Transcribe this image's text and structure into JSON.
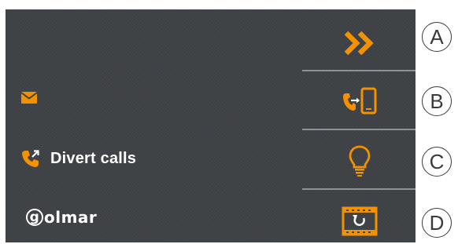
{
  "colors": {
    "accent": "#f39200",
    "screen_bg": "#3f4246",
    "divider": "#8e9196"
  },
  "left_panel": {
    "message_icon": "envelope-icon",
    "divert": {
      "icon": "call-forward-icon",
      "label": "Divert calls"
    },
    "logo": {
      "initial": "g",
      "text": "olmar"
    }
  },
  "right_menu": [
    {
      "id": "A",
      "icon": "double-chevron-right-icon"
    },
    {
      "id": "B",
      "icon": "call-transfer-to-phone-icon"
    },
    {
      "id": "C",
      "icon": "light-bulb-icon"
    },
    {
      "id": "D",
      "icon": "film-refresh-icon"
    }
  ],
  "callouts": [
    "A",
    "B",
    "C",
    "D"
  ]
}
